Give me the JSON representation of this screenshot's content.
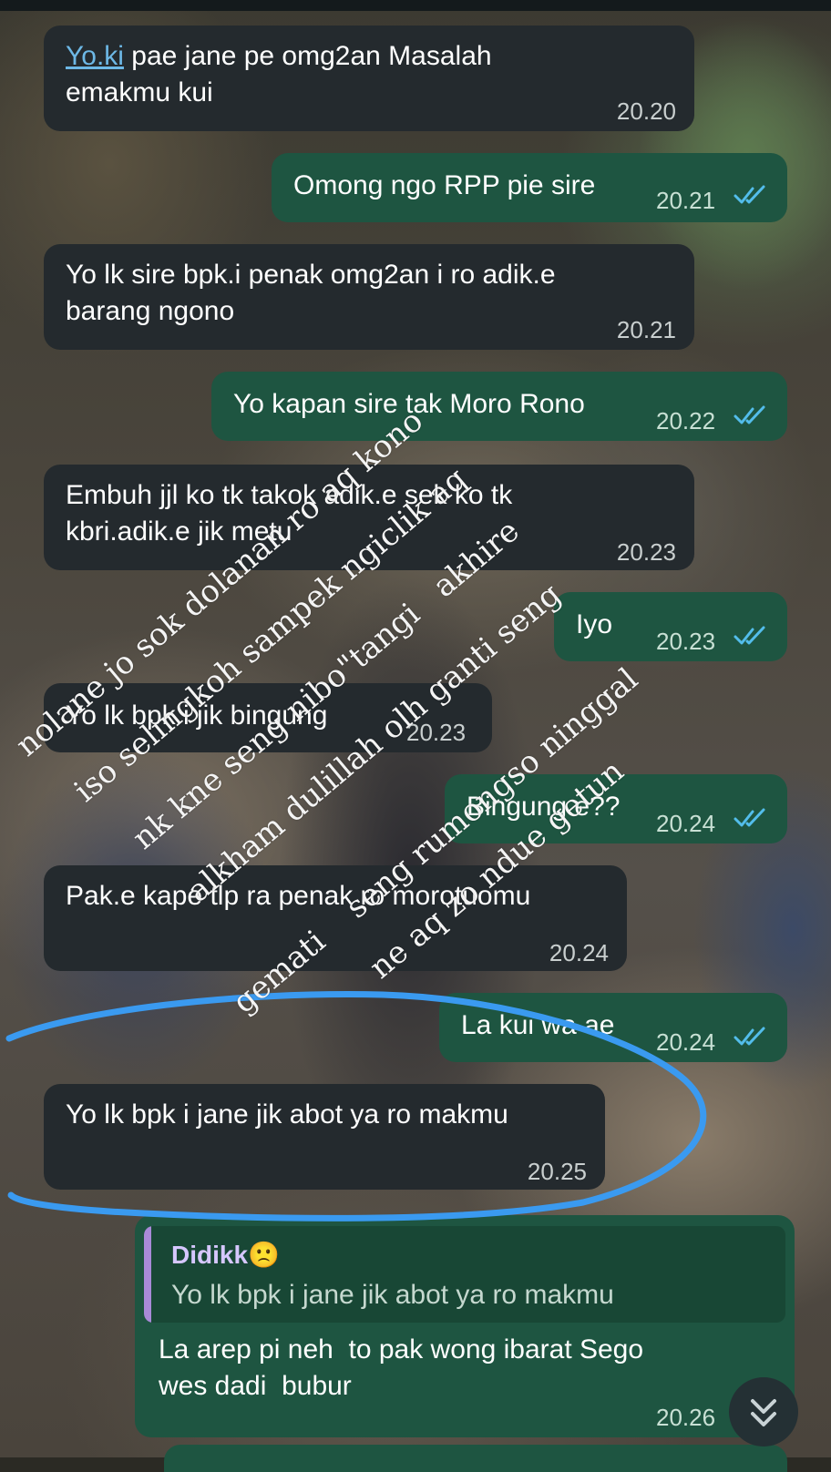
{
  "colors": {
    "incoming_bubble": "#242a2e",
    "outgoing_bubble": "#1e5541",
    "read_ticks": "#53bdeb",
    "annotation_stroke": "#3a9af0"
  },
  "messages": [
    {
      "dir": "in",
      "mention": "Yo.ki",
      "text": " pae jane pe omg2an Masalah",
      "text2": "emakmu kui",
      "time": "20.20"
    },
    {
      "dir": "out",
      "text": "Omong ngo RPP pie sire",
      "time": "20.21",
      "read": true
    },
    {
      "dir": "in",
      "text": "Yo lk sire bpk.i penak omg2an i ro adik.e",
      "text2": "barang ngono",
      "time": "20.21"
    },
    {
      "dir": "out",
      "text": "Yo kapan sire tak Moro Rono",
      "time": "20.22",
      "read": true
    },
    {
      "dir": "in",
      "text": "Embuh jjl ko tk takok adik.e sek ko tk",
      "text2": "kbri.adik.e jik metu",
      "time": "20.23"
    },
    {
      "dir": "out",
      "text": "Iyo",
      "time": "20.23",
      "read": true
    },
    {
      "dir": "in",
      "text": "Yo lk bpk i jik bingung",
      "time": "20.23"
    },
    {
      "dir": "out",
      "text": "Bingung e??",
      "time": "20.24",
      "read": true
    },
    {
      "dir": "in",
      "text": "Pak.e kape tlp ra penak ro morotuomu",
      "time": "20.24"
    },
    {
      "dir": "out",
      "text": "La kui wa ae",
      "time": "20.24",
      "read": true
    },
    {
      "dir": "in",
      "text": "Yo lk bpk i jane jik abot ya ro makmu",
      "time": "20.25"
    },
    {
      "dir": "out",
      "quote_name": "Didikk",
      "quote_emoji": "🙁",
      "quote_text": "Yo lk bpk i jane jik abot ya ro makmu",
      "text": "La arep pi neh  to pak wong ibarat Sego",
      "text2": "wes dadi  bubur",
      "time": "20.26"
    }
  ],
  "handwriting": [
    "nolane jo sok dolanan ro aq kono",
    "iso selingkoh sampek ngiclik aq",
    "nk kne seng nibo\"tangi   akhire",
    "alkham dulillah olh ganti seng",
    "gemati    seng rumongso ninggal",
    "ne aq zo ndue getun"
  ],
  "scroll_down_icon": "double-chevron-down-icon"
}
